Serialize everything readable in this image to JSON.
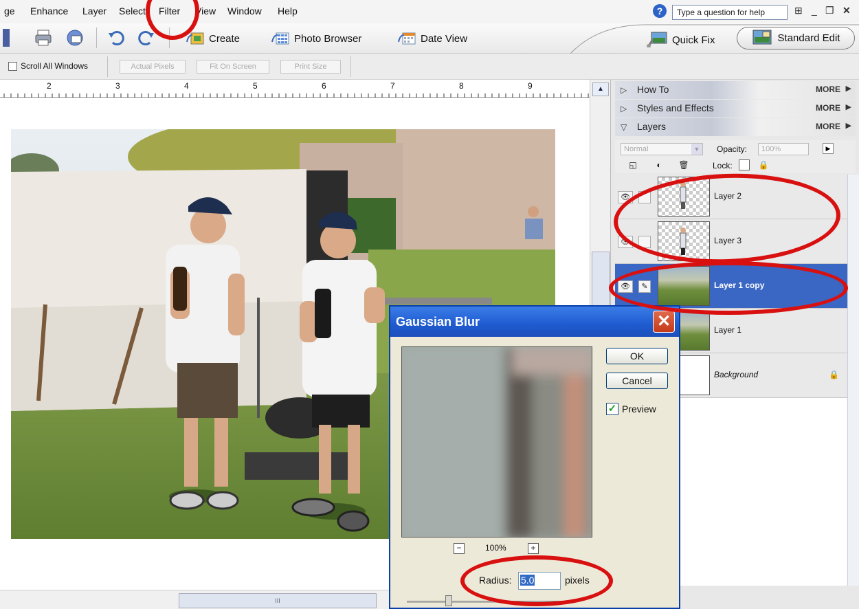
{
  "menubar": {
    "items": [
      "ge",
      "Enhance",
      "Layer",
      "Select",
      "Filter",
      "View",
      "Window",
      "Help"
    ],
    "help_placeholder": "Type a question for help",
    "help_icon": "question-icon"
  },
  "toolbar": {
    "create": "Create",
    "photo_browser": "Photo Browser",
    "date_view": "Date View",
    "quick_fix": "Quick Fix",
    "standard_edit": "Standard Edit"
  },
  "options_bar": {
    "scroll_all": "Scroll All Windows",
    "actual_pixels": "Actual Pixels",
    "fit_on_screen": "Fit On Screen",
    "print_size": "Print Size"
  },
  "ruler": {
    "ticks": [
      "2",
      "3",
      "4",
      "5",
      "6",
      "7",
      "8",
      "9"
    ]
  },
  "palette": {
    "how_to": "How To",
    "styles_effects": "Styles and Effects",
    "layers": "Layers",
    "more": "MORE",
    "blend_mode": "Normal",
    "opacity_label": "Opacity:",
    "opacity_value": "100%",
    "lock_label": "Lock:"
  },
  "layers": [
    {
      "name": "Layer 2",
      "thumb": "transparent-figure",
      "visible": true,
      "selected": false
    },
    {
      "name": "Layer 3",
      "thumb": "transparent-figure",
      "visible": true,
      "selected": false
    },
    {
      "name": "Layer 1 copy",
      "thumb": "photo",
      "visible": true,
      "selected": true
    },
    {
      "name": "Layer 1",
      "thumb": "photo",
      "visible": false,
      "selected": false
    },
    {
      "name": "Background",
      "thumb": "blank",
      "visible": false,
      "selected": false,
      "locked": true
    }
  ],
  "dialog": {
    "title": "Gaussian Blur",
    "ok": "OK",
    "cancel": "Cancel",
    "preview": "Preview",
    "preview_checked": true,
    "zoom": "100%",
    "radius_label": "Radius:",
    "radius_value": "5.0",
    "radius_unit": "pixels"
  },
  "colors": {
    "selected_layer": "#3a66c4",
    "dialog_title": "#1f5bd0",
    "annotation_red": "#d81010"
  }
}
